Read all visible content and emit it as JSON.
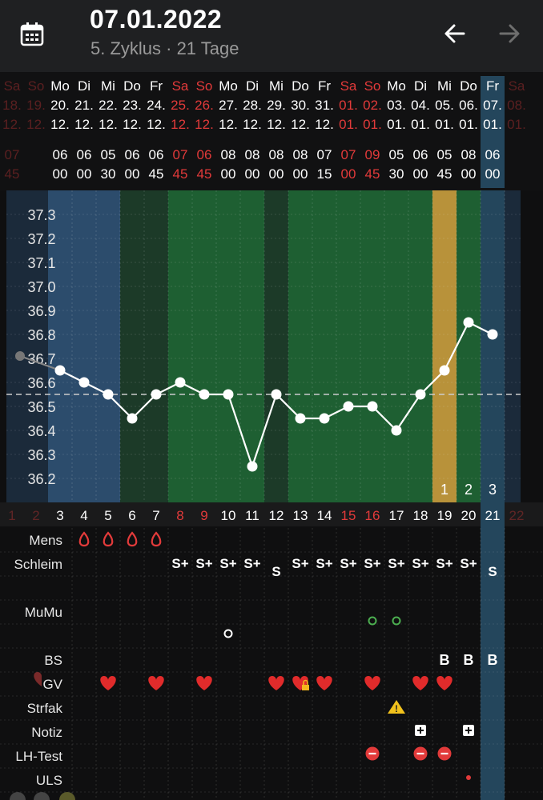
{
  "header": {
    "date": "07.01.2022",
    "subtitle": "5. Zyklus · 21 Tage",
    "icons": {
      "calendar": "calendar-icon",
      "back": "arrow-left-icon",
      "forward": "arrow-right-icon"
    }
  },
  "colors": {
    "background": "#0f0f10",
    "header": "#1f2022",
    "weekend": "#e23a3a",
    "menstruation": "#2c4c6c",
    "fertile": "#1e5f32",
    "infertile": "#1c3a28",
    "ovulation": "#b8923a",
    "today": "#24465c",
    "cover_line": "#cccccc"
  },
  "days": [
    {
      "wd": "Sa",
      "d": "18.",
      "m": "12.",
      "hh": "07",
      "mm": "45",
      "n": "1",
      "w": true,
      "ghost": true
    },
    {
      "wd": "So",
      "d": "19.",
      "m": "12.",
      "hh": "",
      "mm": "",
      "n": "2",
      "w": true,
      "ghost": true
    },
    {
      "wd": "Mo",
      "d": "20.",
      "m": "12.",
      "hh": "06",
      "mm": "00",
      "n": "3",
      "w": false,
      "ghost": false
    },
    {
      "wd": "Di",
      "d": "21.",
      "m": "12.",
      "hh": "06",
      "mm": "00",
      "n": "4",
      "w": false
    },
    {
      "wd": "Mi",
      "d": "22.",
      "m": "12.",
      "hh": "05",
      "mm": "30",
      "n": "5",
      "w": false
    },
    {
      "wd": "Do",
      "d": "23.",
      "m": "12.",
      "hh": "06",
      "mm": "00",
      "n": "6",
      "w": false
    },
    {
      "wd": "Fr",
      "d": "24.",
      "m": "12.",
      "hh": "06",
      "mm": "45",
      "n": "7",
      "w": false
    },
    {
      "wd": "Sa",
      "d": "25.",
      "m": "12.",
      "hh": "07",
      "mm": "45",
      "n": "8",
      "w": true
    },
    {
      "wd": "So",
      "d": "26.",
      "m": "12.",
      "hh": "06",
      "mm": "45",
      "n": "9",
      "w": true
    },
    {
      "wd": "Mo",
      "d": "27.",
      "m": "12.",
      "hh": "08",
      "mm": "00",
      "n": "10",
      "w": false
    },
    {
      "wd": "Di",
      "d": "28.",
      "m": "12.",
      "hh": "08",
      "mm": "00",
      "n": "11",
      "w": false
    },
    {
      "wd": "Mi",
      "d": "29.",
      "m": "12.",
      "hh": "08",
      "mm": "00",
      "n": "12",
      "w": false
    },
    {
      "wd": "Do",
      "d": "30.",
      "m": "12.",
      "hh": "08",
      "mm": "00",
      "n": "13",
      "w": false
    },
    {
      "wd": "Fr",
      "d": "31.",
      "m": "12.",
      "hh": "07",
      "mm": "15",
      "n": "14",
      "w": false
    },
    {
      "wd": "Sa",
      "d": "01.",
      "m": "01.",
      "hh": "07",
      "mm": "00",
      "n": "15",
      "w": true
    },
    {
      "wd": "So",
      "d": "02.",
      "m": "01.",
      "hh": "09",
      "mm": "45",
      "n": "16",
      "w": true
    },
    {
      "wd": "Mo",
      "d": "03.",
      "m": "01.",
      "hh": "05",
      "mm": "30",
      "n": "17",
      "w": false
    },
    {
      "wd": "Di",
      "d": "04.",
      "m": "01.",
      "hh": "06",
      "mm": "00",
      "n": "18",
      "w": false
    },
    {
      "wd": "Mi",
      "d": "05.",
      "m": "01.",
      "hh": "05",
      "mm": "45",
      "n": "19",
      "w": false
    },
    {
      "wd": "Do",
      "d": "06.",
      "m": "01.",
      "hh": "08",
      "mm": "00",
      "n": "20",
      "w": false
    },
    {
      "wd": "Fr",
      "d": "07.",
      "m": "01.",
      "hh": "06",
      "mm": "00",
      "n": "21",
      "w": false,
      "today": true
    },
    {
      "wd": "Sa",
      "d": "08.",
      "m": "01.",
      "hh": "",
      "mm": "",
      "n": "22",
      "w": true,
      "ghost": true
    }
  ],
  "chart_data": {
    "type": "line",
    "x": [
      "1",
      "2",
      "3",
      "4",
      "5",
      "6",
      "7",
      "8",
      "9",
      "10",
      "11",
      "12",
      "13",
      "14",
      "15",
      "16",
      "17",
      "18",
      "19",
      "20",
      "21"
    ],
    "series": [
      {
        "values": [
          null,
          36.7,
          36.65,
          36.6,
          36.55,
          36.45,
          36.55,
          36.6,
          36.55,
          36.55,
          36.25,
          36.55,
          36.45,
          36.45,
          36.5,
          36.5,
          36.4,
          36.55,
          36.65,
          36.85,
          36.8
        ]
      }
    ],
    "yticks": [
      "37.3",
      "37.2",
      "37.1",
      "37.0",
      "36.9",
      "36.8",
      "36.7",
      "36.6",
      "36.5",
      "36.4",
      "36.3",
      "36.2"
    ],
    "ylim": [
      36.1,
      37.35
    ],
    "cover_line": 36.55,
    "phases": [
      {
        "from": 3,
        "to": 5,
        "kind": "menstruation"
      },
      {
        "from": 6,
        "to": 7,
        "kind": "infertile"
      },
      {
        "from": 8,
        "to": 11,
        "kind": "fertile"
      },
      {
        "from": 12,
        "to": 12,
        "kind": "infertile"
      },
      {
        "from": 13,
        "to": 18,
        "kind": "fertile"
      },
      {
        "from": 19,
        "to": 19,
        "kind": "ovulation"
      },
      {
        "from": 20,
        "to": 20,
        "kind": "fertile"
      },
      {
        "from": 21,
        "to": 21,
        "kind": "today"
      }
    ],
    "post_ovulation_markers": [
      {
        "day": 19,
        "label": "1"
      },
      {
        "day": 20,
        "label": "2"
      },
      {
        "day": 21,
        "label": "3"
      }
    ]
  },
  "rows": {
    "mens": {
      "label": "Mens",
      "days": [
        4,
        5,
        6,
        7
      ],
      "icon": "blood-drop-icon"
    },
    "schleim": {
      "label": "Schleim",
      "values": {
        "8": "S+",
        "9": "S+",
        "10": "S+",
        "11": "S+",
        "12": "S",
        "13": "S+",
        "14": "S+",
        "15": "S+",
        "16": "S+",
        "17": "S+",
        "18": "S+",
        "19": "S+",
        "20": "S+",
        "21": "S"
      }
    },
    "mumu": {
      "label": "MuMu",
      "marks": [
        {
          "day": 10,
          "kind": "closed",
          "color": "#ffffff"
        },
        {
          "day": 16,
          "kind": "open",
          "color": "#4caf50"
        },
        {
          "day": 17,
          "kind": "open",
          "color": "#4caf50"
        }
      ]
    },
    "bs": {
      "label": "BS",
      "values": {
        "19": "B",
        "20": "B",
        "21": "B"
      }
    },
    "gv": {
      "label": "GV",
      "days": [
        5,
        7,
        9,
        12,
        13,
        14,
        16,
        18,
        19
      ],
      "locked_day": 13,
      "icon": "heart-icon"
    },
    "strfak": {
      "label": "Strfak",
      "days": [
        17
      ],
      "icon": "warning-icon"
    },
    "notiz": {
      "label": "Notiz",
      "days": [
        18,
        20
      ],
      "icon": "note-plus-icon"
    },
    "lh": {
      "label": "LH-Test",
      "days": [
        16,
        18,
        19
      ],
      "icon": "minus-circle-icon"
    },
    "uls": {
      "label": "ULS",
      "days": [
        20
      ],
      "icon": "dot-icon"
    }
  }
}
